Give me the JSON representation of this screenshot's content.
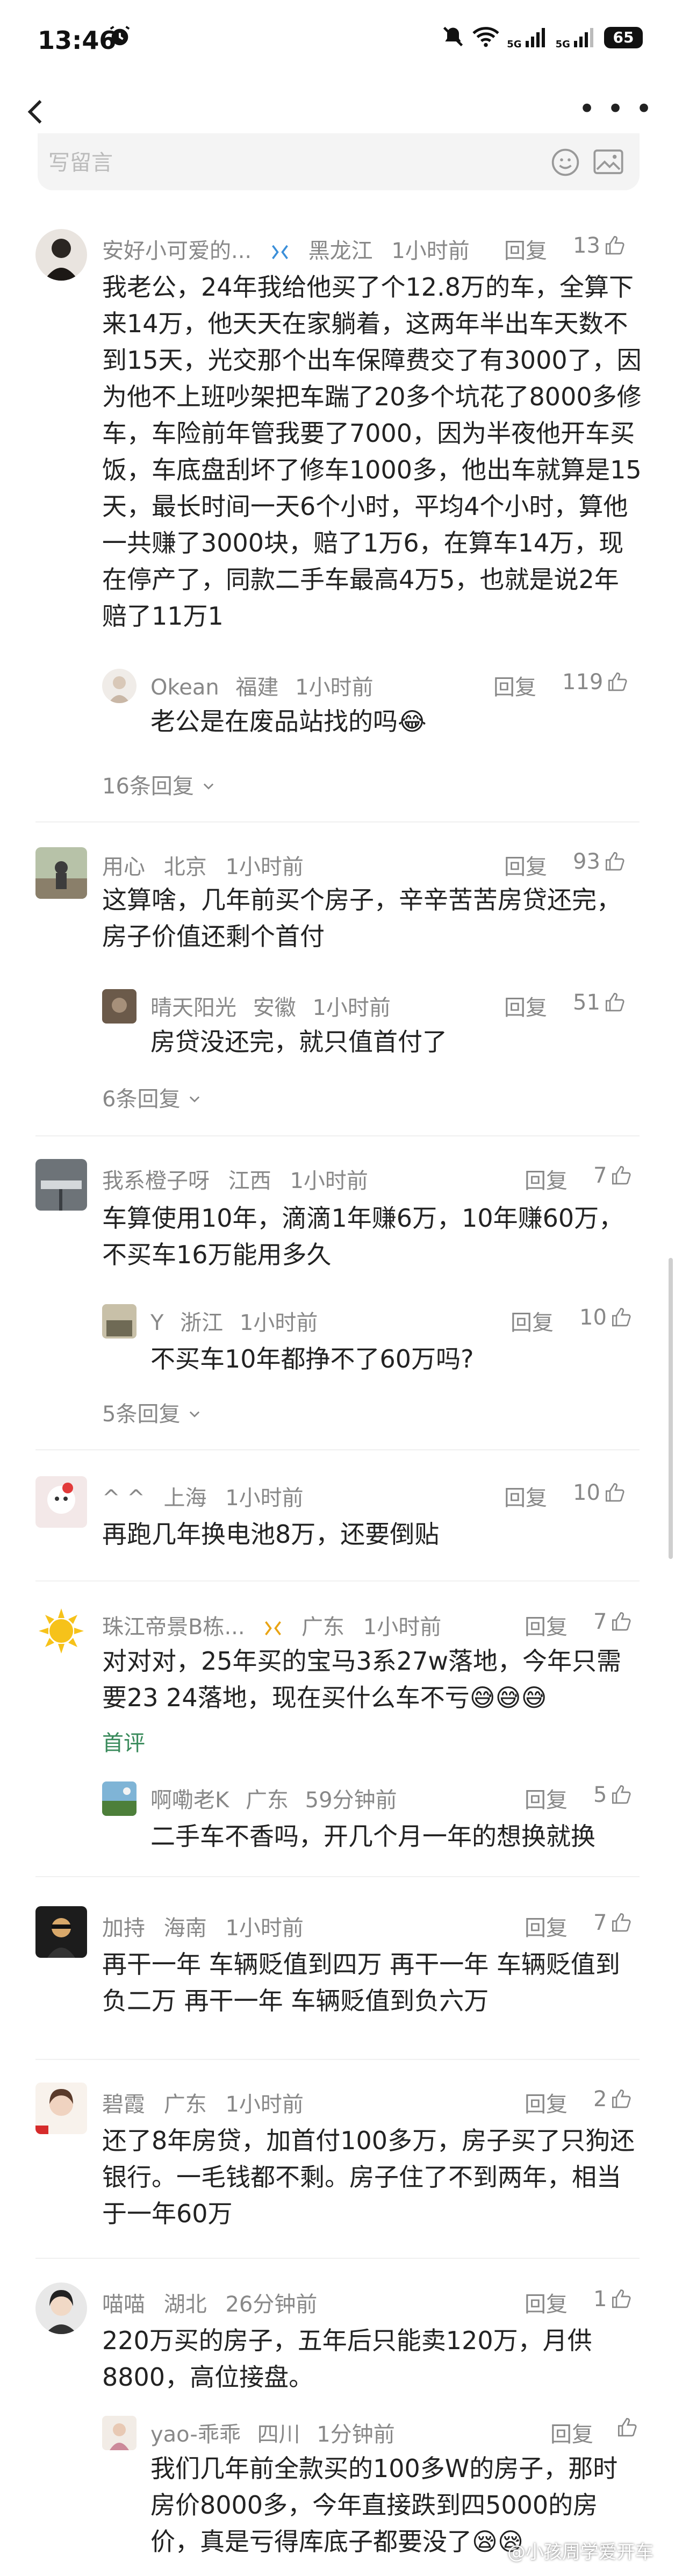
{
  "status_bar": {
    "time": "13:46",
    "network_5g_1": "5G",
    "network_5g_2": "5G",
    "battery": "65"
  },
  "input": {
    "placeholder": "写留言"
  },
  "comments": [
    {
      "user": "安好小可爱的...",
      "region": "黑龙江",
      "time": "1小时前",
      "reply_label": "回复",
      "likes": "13",
      "text": "我老公，24年我给他买了个12.8万的车，全算下来14万，他天天在家躺着，这两年半出车天数不到15天，光交那个出车保障费交了有3000了，因为他不上班吵架把车踹了20多个坑花了8000多修车，车险前年管我要了7000，因为半夜他开车买饭，车底盘刮坏了修车1000多，他出车就算是15天，最长时间一天6个小时，平均4个小时，算他一共赚了3000块，赔了1万6，在算车14万，现在停产了，同款二手车最高4万5，也就是说2年赔了11万1",
      "reply": {
        "user": "Okean",
        "region": "福建",
        "time": "1小时前",
        "reply_label": "回复",
        "likes": "119",
        "text": "老公是在废品站找的吗😂"
      },
      "more_replies": "16条回复"
    },
    {
      "user": "用心",
      "region": "北京",
      "time": "1小时前",
      "reply_label": "回复",
      "likes": "93",
      "text": "这算啥，几年前买个房子，辛辛苦苦房贷还完，房子价值还剩个首付",
      "reply": {
        "user": "晴天阳光",
        "region": "安徽",
        "time": "1小时前",
        "reply_label": "回复",
        "likes": "51",
        "text": "房贷没还完，就只值首付了"
      },
      "more_replies": "6条回复"
    },
    {
      "user": "我系橙子呀",
      "region": "江西",
      "time": "1小时前",
      "reply_label": "回复",
      "likes": "7",
      "text": "车算使用10年，滴滴1年赚6万，10年赚60万，不买车16万能用多久",
      "reply": {
        "user": "Y",
        "region": "浙江",
        "time": "1小时前",
        "reply_label": "回复",
        "likes": "10",
        "text": "不买车10年都挣不了60万吗?"
      },
      "more_replies": "5条回复"
    },
    {
      "user": "^ ^",
      "region": "上海",
      "time": "1小时前",
      "reply_label": "回复",
      "likes": "10",
      "text": "再跑几年换电池8万，还要倒贴"
    },
    {
      "user": "珠江帝景B栋...",
      "region": "广东",
      "time": "1小时前",
      "reply_label": "回复",
      "likes": "7",
      "text": "对对对，25年买的宝马3系27w落地，今年只需要23 24落地，现在买什么车不亏😅😅😅",
      "tag": "首评",
      "reply": {
        "user": "啊嘞老K",
        "region": "广东",
        "time": "59分钟前",
        "reply_label": "回复",
        "likes": "5",
        "text": "二手车不香吗，开几个月一年的想换就换"
      }
    },
    {
      "user": "加持",
      "region": "海南",
      "time": "1小时前",
      "reply_label": "回复",
      "likes": "7",
      "text": "再干一年 车辆贬值到四万 再干一年 车辆贬值到负二万 再干一年 车辆贬值到负六万"
    },
    {
      "user": "碧霞",
      "region": "广东",
      "time": "1小时前",
      "reply_label": "回复",
      "likes": "2",
      "text": "还了8年房贷，加首付100多万，房子买了只狗还银行。一毛钱都不剩。房子住了不到两年，相当于一年60万"
    },
    {
      "user": "喵喵",
      "region": "湖北",
      "time": "26分钟前",
      "reply_label": "回复",
      "likes": "1",
      "text": "220万买的房子，五年后只能卖120万，月供8800，高位接盘。",
      "reply": {
        "user": "yao-乖乖",
        "region": "四川",
        "time": "1分钟前",
        "reply_label": "回复",
        "likes": "",
        "text": "我们几年前全款买的100多W的房子，那时房价8000多，今年直接跌到四5000的房价，真是亏得库底子都要没了😪😪"
      }
    }
  ],
  "watermark": "@小孩周学爱开车",
  "colors": {
    "accent_green": "#3a8b5c",
    "meta_gray": "#888888",
    "text": "#222222"
  }
}
